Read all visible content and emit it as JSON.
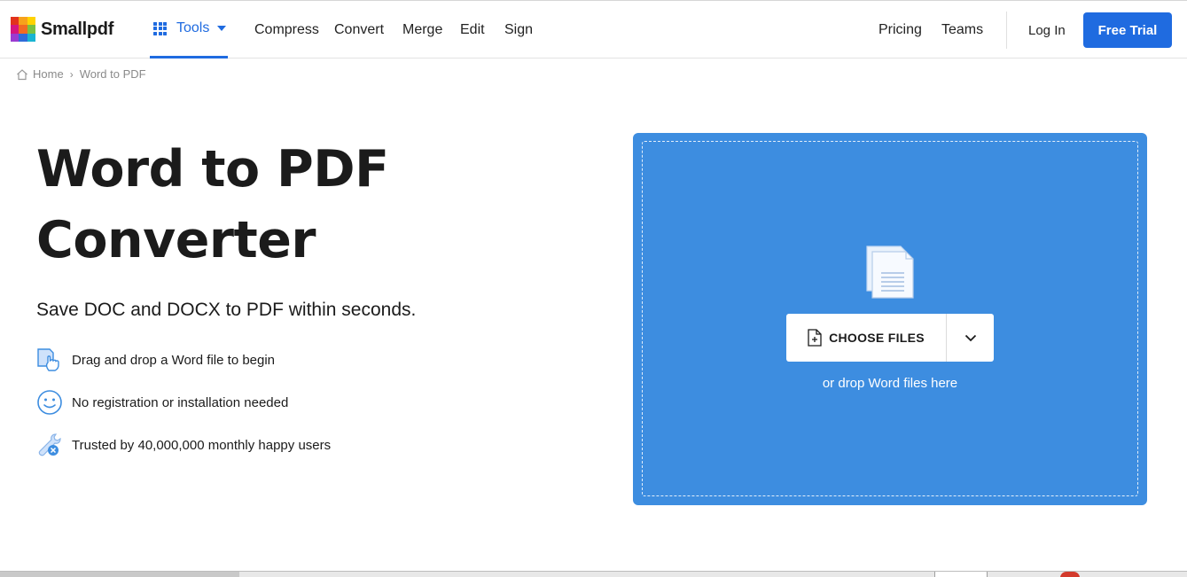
{
  "header": {
    "logo_text": "Smallpdf",
    "tools_label": "Tools",
    "nav": [
      "Compress",
      "Convert",
      "Merge",
      "Edit",
      "Sign"
    ],
    "right_nav": [
      "Pricing",
      "Teams"
    ],
    "login_label": "Log In",
    "trial_label": "Free Trial"
  },
  "breadcrumb": {
    "home": "Home",
    "separator": "›",
    "current": "Word to PDF"
  },
  "hero": {
    "title_line1": "Word to PDF",
    "title_line2": "Converter",
    "subtitle": "Save DOC and DOCX to PDF within seconds.",
    "features": [
      {
        "icon": "drag-drop-hand-icon",
        "text": "Drag and drop a Word file to begin"
      },
      {
        "icon": "smiley-icon",
        "text": "No registration or installation needed"
      },
      {
        "icon": "wrench-badge-icon",
        "text": "Trusted by 40,000,000 monthly happy users"
      }
    ]
  },
  "dropzone": {
    "choose_label": "CHOOSE FILES",
    "drop_hint": "or drop Word files here"
  },
  "colors": {
    "brand_blue": "#1f6be0",
    "dropzone_blue": "#3d8de0"
  }
}
